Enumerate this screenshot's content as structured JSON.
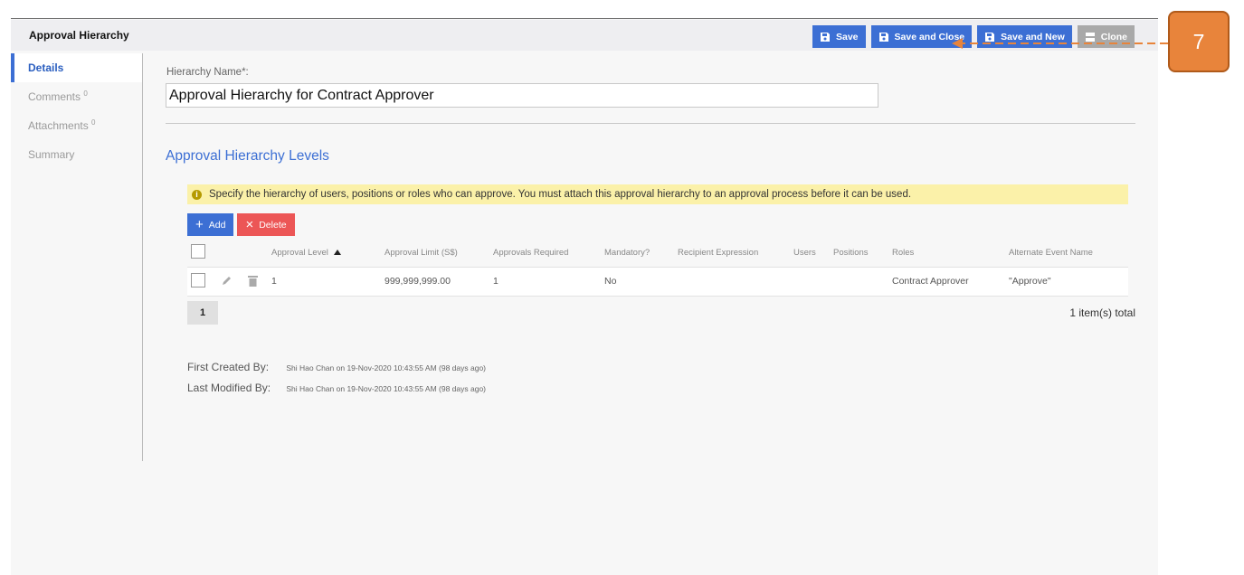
{
  "header": {
    "title": "Approval Hierarchy",
    "toolbar": {
      "save": "Save",
      "save_close": "Save and Close",
      "save_new": "Save and New",
      "clone": "Clone"
    }
  },
  "sidebar": {
    "items": [
      {
        "label": "Details",
        "count": ""
      },
      {
        "label": "Comments",
        "count": "0"
      },
      {
        "label": "Attachments",
        "count": "0"
      },
      {
        "label": "Summary",
        "count": ""
      }
    ]
  },
  "form": {
    "name_label": "Hierarchy Name*:",
    "name_value": "Approval Hierarchy for Contract Approver"
  },
  "section": {
    "title": "Approval Hierarchy Levels",
    "info": "Specify the hierarchy of users, positions or roles who can approve. You must attach this approval hierarchy to an approval process before it can be used.",
    "add_label": "Add",
    "delete_label": "Delete"
  },
  "table": {
    "columns": {
      "level": "Approval Level",
      "limit": "Approval Limit (S$)",
      "required": "Approvals Required",
      "mandatory": "Mandatory?",
      "recipient": "Recipient Expression",
      "users": "Users",
      "positions": "Positions",
      "roles": "Roles",
      "alternate": "Alternate Event Name"
    },
    "rows": [
      {
        "level": "1",
        "limit": "999,999,999.00",
        "required": "1",
        "mandatory": "No",
        "recipient": "",
        "users": "",
        "positions": "",
        "roles": "Contract Approver",
        "alternate": "\"Approve\""
      }
    ]
  },
  "pager": {
    "page": "1",
    "total": "1 item(s) total"
  },
  "audit": {
    "created_label": "First Created By:",
    "created_value": "Shi Hao Chan on 19-Nov-2020 10:43:55 AM (98 days ago)",
    "modified_label": "Last Modified By:",
    "modified_value": "Shi Hao Chan on 19-Nov-2020 10:43:55 AM (98 days ago)"
  },
  "callout": {
    "number": "7",
    "color": "#e8843b"
  },
  "colors": {
    "accent": "#3c6fd4",
    "danger": "#ec5656",
    "info_bg": "#fbf1a9"
  }
}
